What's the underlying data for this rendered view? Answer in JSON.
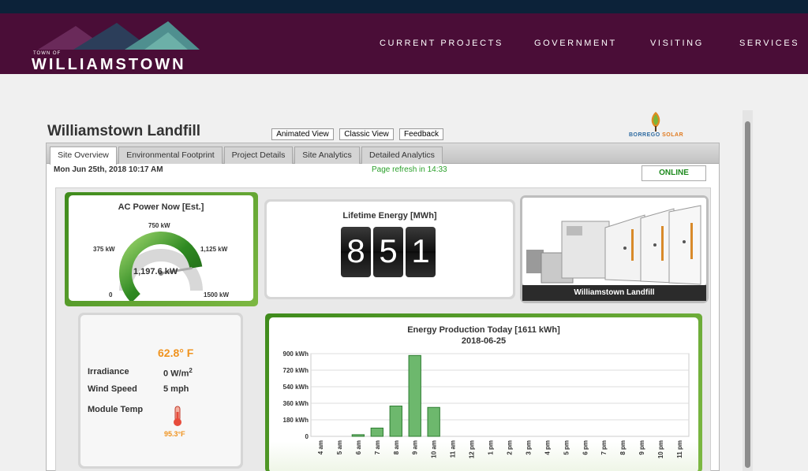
{
  "site": {
    "logo_small": "TOWN OF",
    "logo_name": "WILLIAMSTOWN",
    "nav": [
      "CURRENT PROJECTS",
      "GOVERNMENT",
      "VISITING",
      "SERVICES"
    ]
  },
  "page": {
    "title": "Williamstown Landfill",
    "view_buttons": [
      "Animated View",
      "Classic View",
      "Feedback"
    ],
    "brand": {
      "word1": "BORREGO",
      "word2": "SOLAR"
    }
  },
  "tabs": [
    "Site Overview",
    "Environmental Footprint",
    "Project Details",
    "Site Analytics",
    "Detailed Analytics"
  ],
  "status": {
    "datetime": "Mon Jun 25th, 2018 10:17 AM",
    "refresh": "Page refresh in 14:33",
    "online": "ONLINE"
  },
  "ac_power": {
    "title": "AC Power Now [Est.]",
    "value": "1,197.6 kW",
    "value_num": 1197.6,
    "max": 1500,
    "ticks": [
      "0",
      "375 kW",
      "750 kW",
      "1,125 kW",
      "1500 kW"
    ]
  },
  "lifetime": {
    "title": "Lifetime Energy [MWh]",
    "digits": [
      "8",
      "5",
      "1"
    ]
  },
  "site_image": {
    "caption": "Williamstown Landfill"
  },
  "weather": {
    "temperature": "62.8° F",
    "irradiance_label": "Irradiance",
    "irradiance_value": "0 W/m",
    "irradiance_sup": "2",
    "wind_label": "Wind Speed",
    "wind_value": "5 mph",
    "module_label": "Module Temp",
    "module_value": "95.3°F"
  },
  "chart_data": {
    "type": "bar",
    "title": "Energy Production Today [1611 kWh]",
    "subtitle": "2018-06-25",
    "categories": [
      "4 am",
      "5 am",
      "6 am",
      "7 am",
      "8 am",
      "9 am",
      "10 am",
      "11 am",
      "12 pm",
      "1 pm",
      "2 pm",
      "3 pm",
      "4 pm",
      "5 pm",
      "6 pm",
      "7 pm",
      "8 pm",
      "9 pm",
      "10 pm",
      "11 pm"
    ],
    "values": [
      0,
      0,
      18,
      90,
      330,
      880,
      315,
      0,
      0,
      0,
      0,
      0,
      0,
      0,
      0,
      0,
      0,
      0,
      0,
      0
    ],
    "yticks": [
      "0",
      "180 kWh",
      "360 kWh",
      "540 kWh",
      "720 kWh",
      "900 kWh"
    ],
    "ylim": [
      0,
      900
    ],
    "grid": true
  }
}
